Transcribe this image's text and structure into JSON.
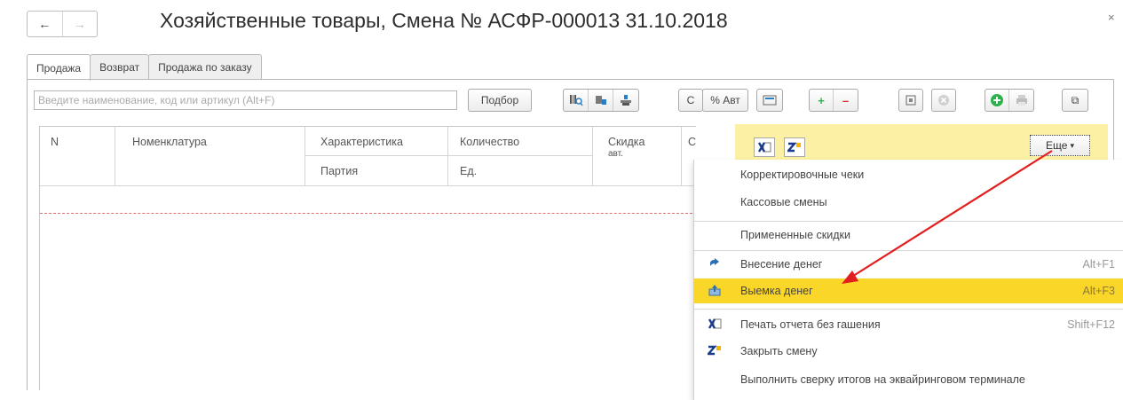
{
  "window": {
    "title": "Хозяйственные товары, Смена № АСФР-000013  31.10.2018",
    "back_symbol": "←",
    "forward_symbol": "→",
    "close_symbol": "×"
  },
  "tabs": [
    {
      "label": "Продажа",
      "active": true
    },
    {
      "label": "Возврат",
      "active": false
    },
    {
      "label": "Продажа по заказу",
      "active": false
    }
  ],
  "toolbar": {
    "search_placeholder": "Введите наименование, код или артикул (Alt+F)",
    "select_label": "Подбор",
    "discount_label": "% Авт",
    "refresh_symbol": "C",
    "plus_symbol": "+",
    "minus_symbol": "–",
    "restore_symbol": "⧉"
  },
  "table": {
    "headers": {
      "n": "N",
      "nomenclature": "Номенклатура",
      "characteristic": "Характеристика",
      "quantity": "Количество",
      "discount": "Скидка",
      "discount_sub": "авт.",
      "cut": "С",
      "batch": "Партия",
      "unit": "Ед."
    }
  },
  "side_panel": {
    "more_label": "Еще",
    "more_caret": "▾"
  },
  "menu": {
    "items": [
      {
        "label": "Корректировочные чеки",
        "shortcut": ""
      },
      {
        "label": "Кассовые смены",
        "shortcut": ""
      },
      {
        "label": "Примененные скидки",
        "shortcut": ""
      },
      {
        "label": "Внесение денег",
        "shortcut": "Alt+F1"
      },
      {
        "label": "Выемка денег",
        "shortcut": "Alt+F3",
        "highlighted": true
      },
      {
        "label": "Печать отчета без гашения",
        "shortcut": "Shift+F12"
      },
      {
        "label": "Закрыть смену",
        "shortcut": ""
      },
      {
        "label": "Выполнить сверку итогов на эквайринговом терминале",
        "shortcut": ""
      }
    ]
  },
  "colors": {
    "highlight": "#fad629",
    "panel": "#fbf0a3",
    "arrow": "#e31e1e",
    "green": "#2bb24c",
    "red": "#d9302c"
  }
}
